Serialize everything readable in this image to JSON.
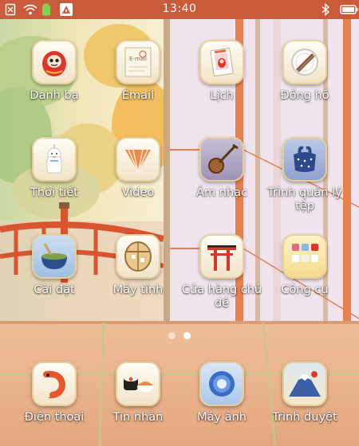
{
  "status_bar": {
    "time": "13:40",
    "left_icons": [
      "sim-icon",
      "wifi-icon",
      "battery-icon",
      "app-notification-icon"
    ],
    "right_icons": [
      "bluetooth-icon",
      "battery-status-icon"
    ],
    "color": "#c95b3a"
  },
  "apps": [
    {
      "name": "app-contacts",
      "label": "Danh bạ",
      "icon": "daruma-icon"
    },
    {
      "name": "app-email",
      "label": "Email",
      "icon": "envelope-icon"
    },
    {
      "name": "app-calendar",
      "label": "Lịch",
      "icon": "calendar-icon"
    },
    {
      "name": "app-clock",
      "label": "Đồng hồ",
      "icon": "clock-icon"
    },
    {
      "name": "app-weather",
      "label": "Thời tiết",
      "icon": "teru-teru-bozu-icon"
    },
    {
      "name": "app-video",
      "label": "Video",
      "icon": "fan-icon"
    },
    {
      "name": "app-music",
      "label": "Âm nhạc",
      "icon": "shamisen-icon"
    },
    {
      "name": "app-file-manager",
      "label": "Trình quản lý tệp",
      "icon": "furoshiki-icon"
    },
    {
      "name": "app-settings",
      "label": "Cài đặt",
      "icon": "matcha-icon"
    },
    {
      "name": "app-calculator",
      "label": "Máy tính",
      "icon": "abacus-icon"
    },
    {
      "name": "app-theme-store",
      "label": "Cửa hàng chủ đề",
      "icon": "torii-icon"
    },
    {
      "name": "app-tools",
      "label": "Công cụ",
      "icon": "tools-icon"
    }
  ],
  "dock": [
    {
      "name": "dock-phone",
      "label": "Điện thoại",
      "icon": "shrimp-icon"
    },
    {
      "name": "dock-messages",
      "label": "Tin nhắn",
      "icon": "sushi-icon"
    },
    {
      "name": "dock-camera",
      "label": "Máy ảnh",
      "icon": "camera-icon"
    },
    {
      "name": "dock-browser",
      "label": "Trình duyệt",
      "icon": "mount-fuji-icon"
    }
  ],
  "page_indicator": {
    "pages": 2,
    "current": 2
  }
}
